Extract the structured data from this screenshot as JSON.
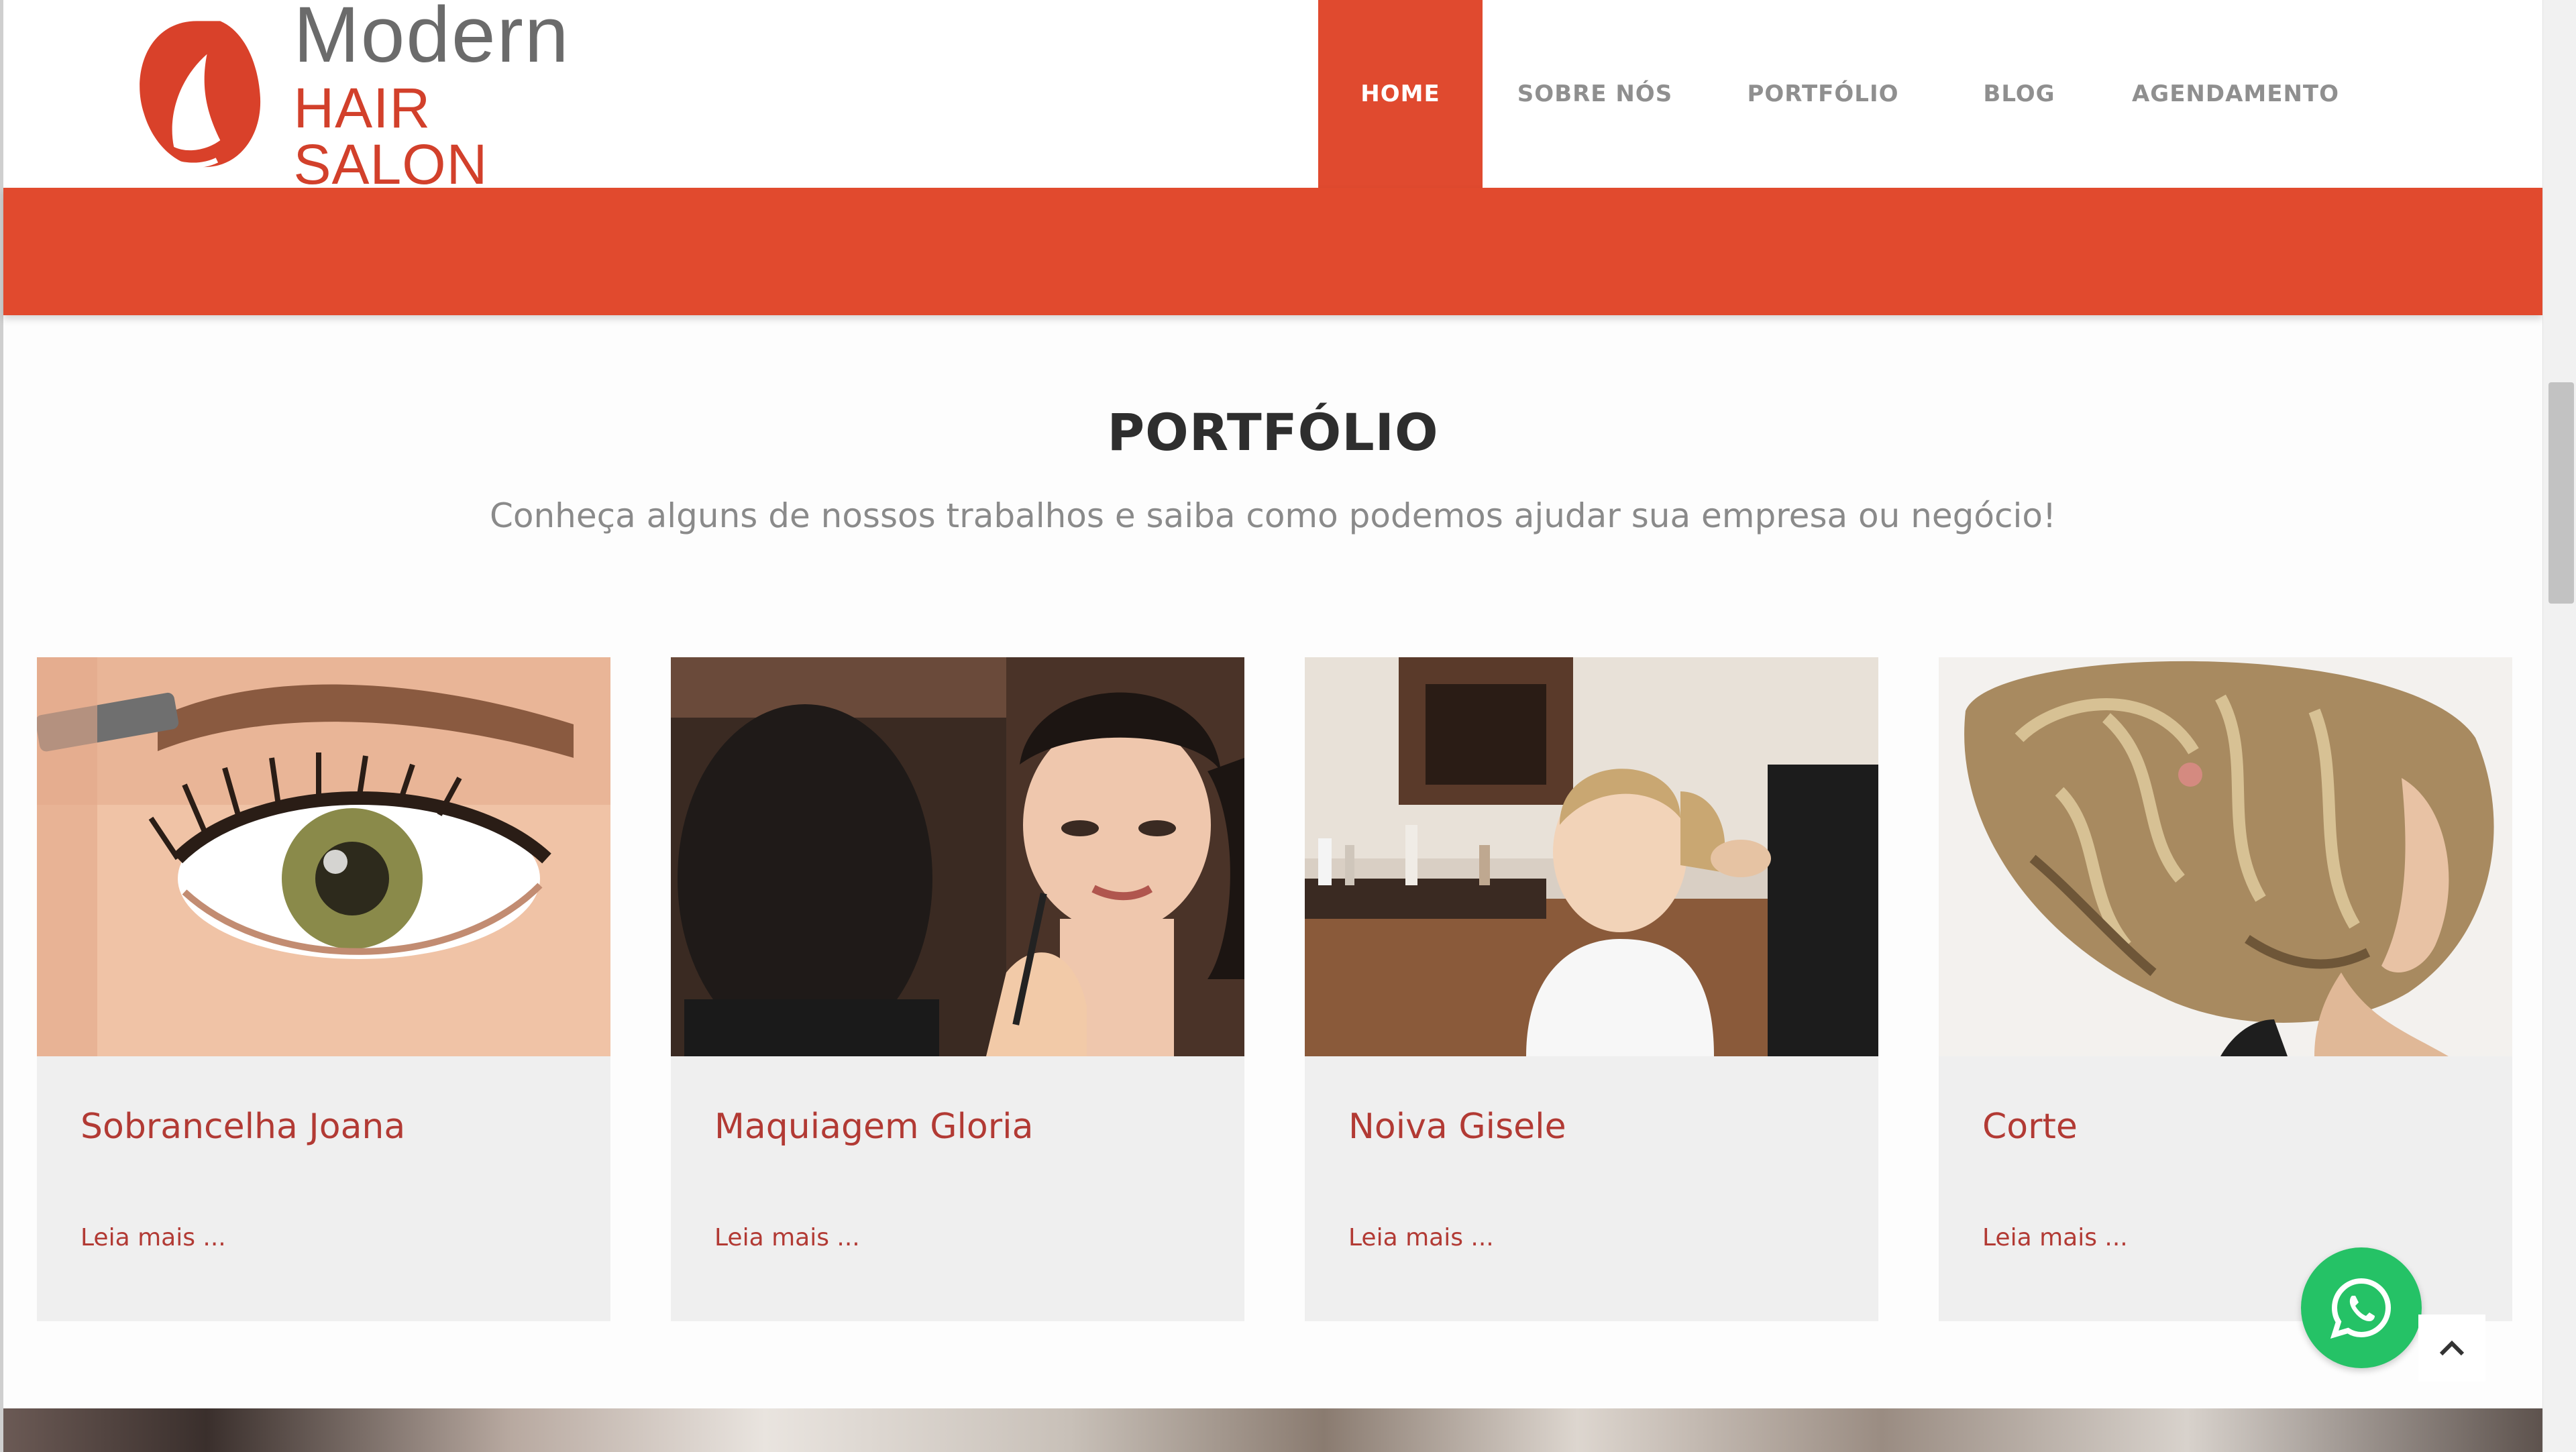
{
  "brand": {
    "line1": "Modern",
    "line2": "HAIR SALON",
    "primary_color": "#e04a2f",
    "text_color": "#6b6b6b"
  },
  "nav": {
    "items": [
      {
        "label": "HOME",
        "active": true
      },
      {
        "label": "SOBRE NÓS",
        "active": false
      },
      {
        "label": "PORTFÓLIO",
        "active": false
      },
      {
        "label": "BLOG",
        "active": false
      },
      {
        "label": "AGENDAMENTO",
        "active": false
      }
    ]
  },
  "section": {
    "title": "PORTFÓLIO",
    "subtitle": "Conheça alguns de nossos trabalhos e saiba como podemos ajudar sua empresa ou negócio!"
  },
  "cards": [
    {
      "title": "Sobrancelha Joana",
      "link": "Leia mais ...",
      "image": "eyebrow-photo"
    },
    {
      "title": "Maquiagem Gloria",
      "link": "Leia mais ...",
      "image": "makeup-photo"
    },
    {
      "title": "Noiva Gisele",
      "link": "Leia mais ...",
      "image": "bride-photo"
    },
    {
      "title": "Corte",
      "link": "Leia mais ...",
      "image": "haircut-photo"
    }
  ],
  "widgets": {
    "whatsapp_color": "#25c266",
    "whatsapp_icon": "whatsapp-icon",
    "to_top_icon": "chevron-up-icon"
  }
}
